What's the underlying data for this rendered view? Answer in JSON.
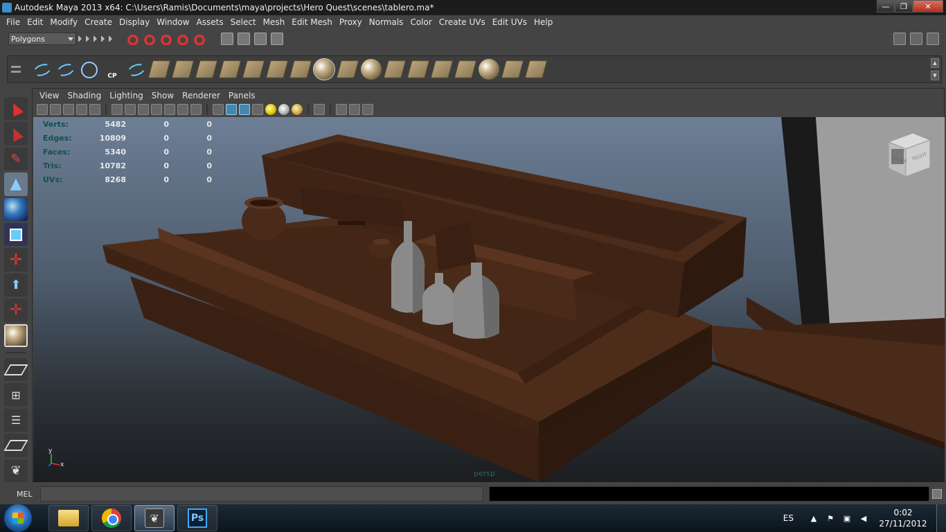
{
  "window": {
    "title": "Autodesk Maya 2013 x64: C:\\Users\\Ramis\\Documents\\maya\\projects\\Hero Quest\\scenes\\tablero.ma*",
    "minimize": "—",
    "maximize": "❐",
    "close": "✕"
  },
  "menubar": [
    "File",
    "Edit",
    "Modify",
    "Create",
    "Display",
    "Window",
    "Assets",
    "Select",
    "Mesh",
    "Edit Mesh",
    "Proxy",
    "Normals",
    "Color",
    "Create UVs",
    "Edit UVs",
    "Help"
  ],
  "statusline": {
    "mode": "Polygons"
  },
  "panel": {
    "menu": [
      "View",
      "Shading",
      "Lighting",
      "Show",
      "Renderer",
      "Panels"
    ]
  },
  "hud": {
    "rows": [
      {
        "label": "Verts:",
        "v1": "5482",
        "v2": "0",
        "v3": "0"
      },
      {
        "label": "Edges:",
        "v1": "10809",
        "v2": "0",
        "v3": "0"
      },
      {
        "label": "Faces:",
        "v1": "5340",
        "v2": "0",
        "v3": "0"
      },
      {
        "label": "Tris:",
        "v1": "10782",
        "v2": "0",
        "v3": "0"
      },
      {
        "label": "UVs:",
        "v1": "8268",
        "v2": "0",
        "v3": "0"
      }
    ]
  },
  "viewport": {
    "camera": "persp",
    "viewcube": {
      "front": "FRONT",
      "right": "RIGHT"
    },
    "axis": {
      "y": "y",
      "x": "x"
    }
  },
  "shelf": {
    "cp_label": "CP"
  },
  "cmdline": {
    "label": "MEL"
  },
  "taskbar": {
    "lang": "ES",
    "time": "0:02",
    "date": "27/11/2012",
    "ps_label": "Ps"
  },
  "colors": {
    "wood": "#4a2a18",
    "bottle": "#8a8a8a",
    "accent": "#3a8fd0"
  }
}
